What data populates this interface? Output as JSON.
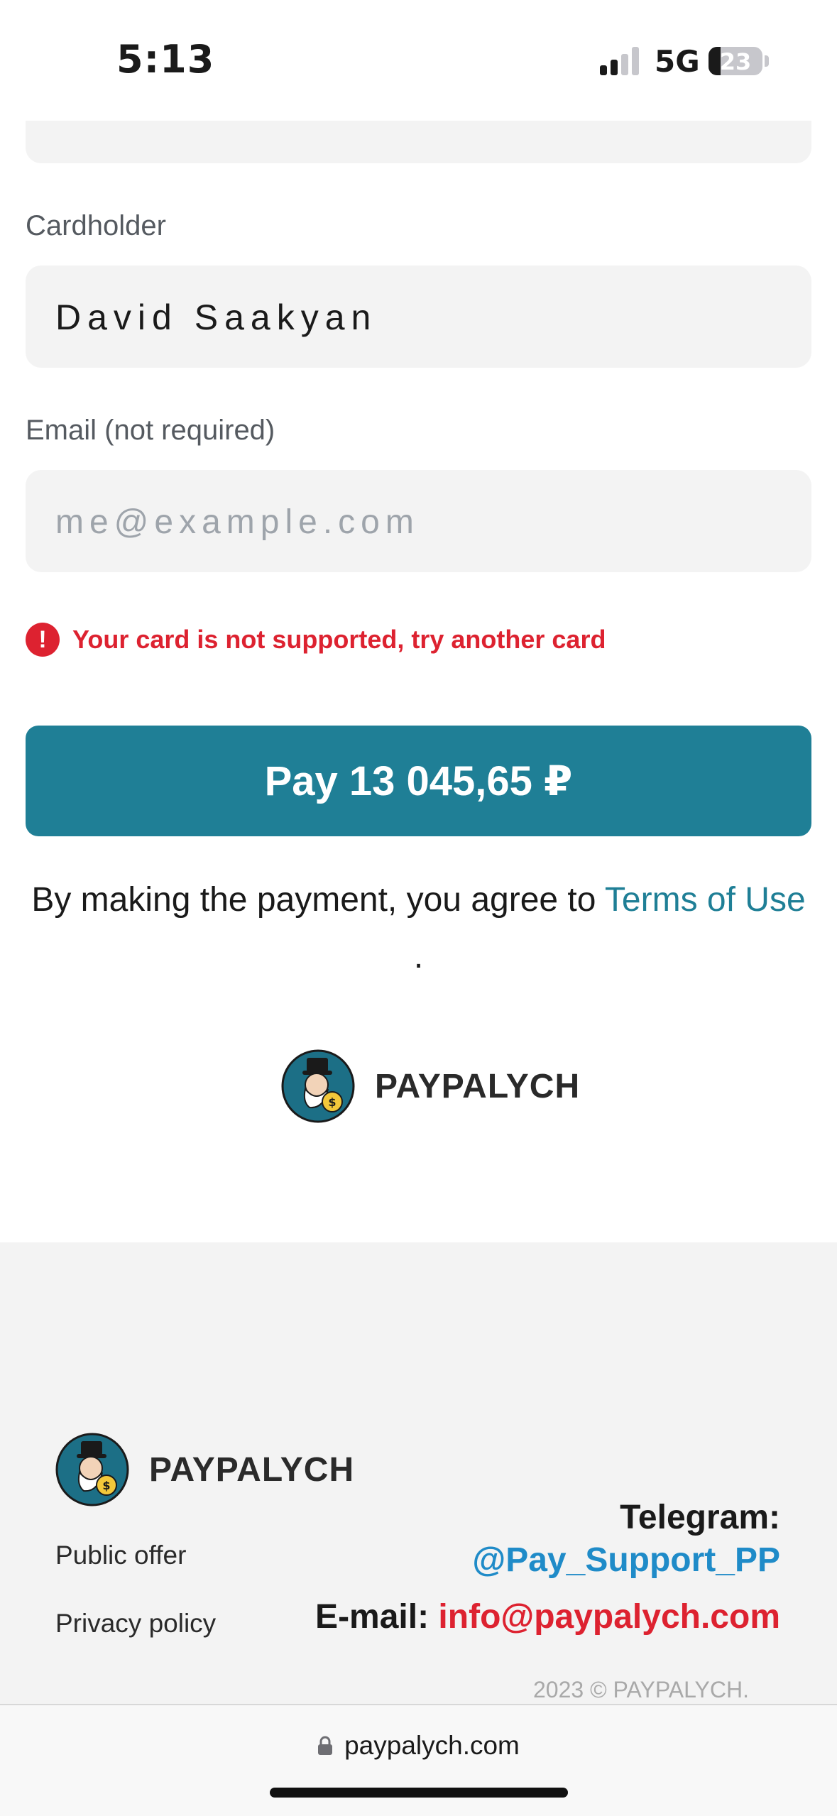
{
  "status_bar": {
    "time": "5:13",
    "network": "5G",
    "battery": "23",
    "battery_level": 0.23,
    "signal_bars_active": 2,
    "signal_bars_total": 4
  },
  "form": {
    "cardholder_label": "Cardholder",
    "cardholder_value": "David Saakyan",
    "email_label": "Email (not required)",
    "email_placeholder": "me@example.com",
    "error_icon": "!",
    "error_message": "Your card is not supported, try another card",
    "pay_button_label": "Pay 13 045,65 ₽",
    "agreement_prefix": "By making the payment, you agree to ",
    "agreement_link": "Terms of Use",
    "agreement_suffix": "."
  },
  "brand": {
    "name": "PAYPALYCH"
  },
  "footer": {
    "brand_name": "PAYPALYCH",
    "public_offer": "Public offer",
    "privacy_policy": "Privacy policy",
    "telegram_label": "Telegram:",
    "telegram_handle": "@Pay_Support_PP",
    "email_label": "E-mail:",
    "email_value": "info@paypalych.com",
    "copyright": "2023 © PAYPALYCH."
  },
  "browser": {
    "url": "paypalych.com"
  },
  "colors": {
    "accent": "#1f7f96",
    "error": "#dd2230",
    "telegram": "#1f8bc8"
  },
  "icons": [
    "signal-icon",
    "battery-icon",
    "error-icon",
    "paypalych-logo-icon",
    "lock-icon"
  ]
}
